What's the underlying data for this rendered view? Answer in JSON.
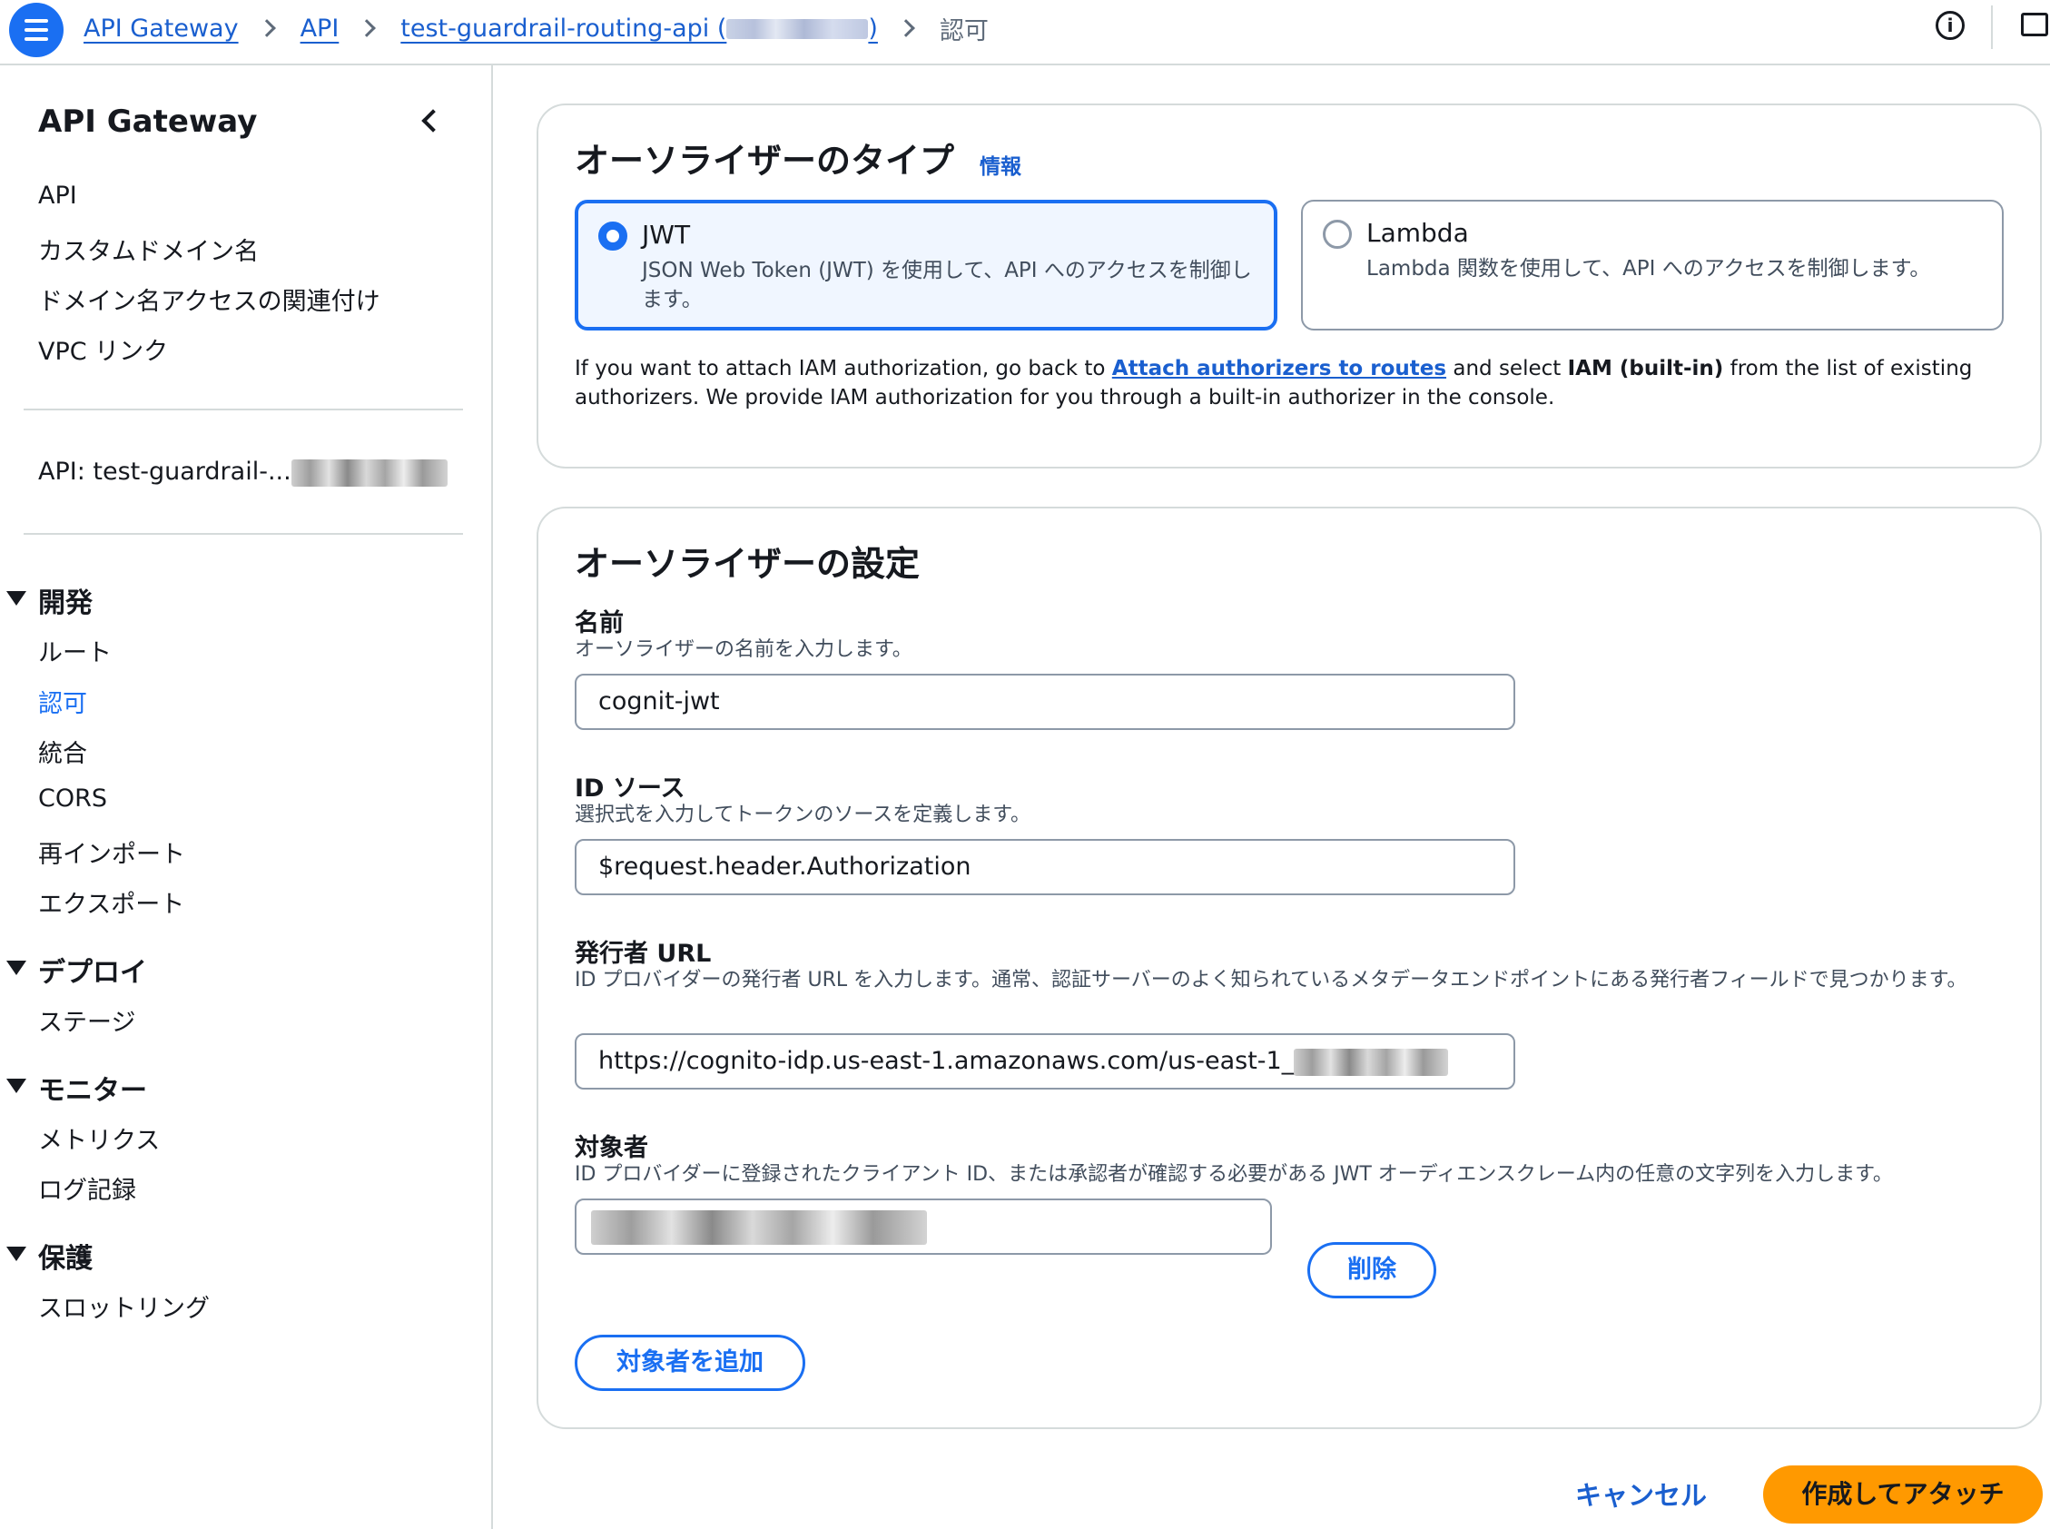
{
  "breadcrumb": {
    "items": [
      "API Gateway",
      "API",
      "test-guardrail-routing-api ("
    ],
    "item3_suffix": ")",
    "current": "認可"
  },
  "sidebar": {
    "title": "API Gateway",
    "top_links": [
      "API",
      "カスタムドメイン名",
      "ドメイン名アクセスの関連付け",
      "VPC リンク"
    ],
    "api_label": "API: test-guardrail-...",
    "sections": [
      {
        "title": "開発",
        "items": [
          "ルート",
          "認可",
          "統合",
          "CORS",
          "再インポート",
          "エクスポート"
        ]
      },
      {
        "title": "デプロイ",
        "items": [
          "ステージ"
        ]
      },
      {
        "title": "モニター",
        "items": [
          "メトリクス",
          "ログ記録"
        ]
      },
      {
        "title": "保護",
        "items": [
          "スロットリング"
        ]
      }
    ],
    "active_item": "認可"
  },
  "authorizer_type": {
    "title": "オーソライザーのタイプ",
    "info": "情報",
    "options": [
      {
        "label": "JWT",
        "description": "JSON Web Token (JWT) を使用して、API へのアクセスを制御します。",
        "selected": true
      },
      {
        "label": "Lambda",
        "description": "Lambda 関数を使用して、API へのアクセスを制御します。",
        "selected": false
      }
    ],
    "iam_note": {
      "part1": "If you want to attach IAM authorization, go back to ",
      "link": "Attach authorizers to routes",
      "part2": " and select ",
      "bold": "IAM (built-in)",
      "part3": " from the list of existing authorizers. We provide IAM authorization for you through a built-in authorizer in the console."
    }
  },
  "authorizer_settings": {
    "title": "オーソライザーの設定",
    "name": {
      "label": "名前",
      "hint": "オーソライザーの名前を入力します。",
      "value": "cognit-jwt"
    },
    "identity_source": {
      "label": "ID ソース",
      "hint": "選択式を入力してトークンのソースを定義します。",
      "value": "$request.header.Authorization"
    },
    "issuer_url": {
      "label": "発行者 URL",
      "hint": "ID プロバイダーの発行者 URL を入力します。通常、認証サーバーのよく知られているメタデータエンドポイントにある発行者フィールドで見つかります。",
      "value": "https://cognito-idp.us-east-1.amazonaws.com/us-east-1_"
    },
    "audience": {
      "label": "対象者",
      "hint": "ID プロバイダーに登録されたクライアント ID、または承認者が確認する必要がある JWT オーディエンスクレーム内の任意の文字列を入力します。",
      "remove_label": "削除",
      "add_label": "対象者を追加"
    }
  },
  "footer": {
    "cancel": "キャンセル",
    "submit": "作成してアタッチ"
  },
  "colors": {
    "accent": "#1a6ff2",
    "link": "#1a5fcf",
    "primary_button": "#ff9900",
    "border": "#d5dbdb"
  }
}
